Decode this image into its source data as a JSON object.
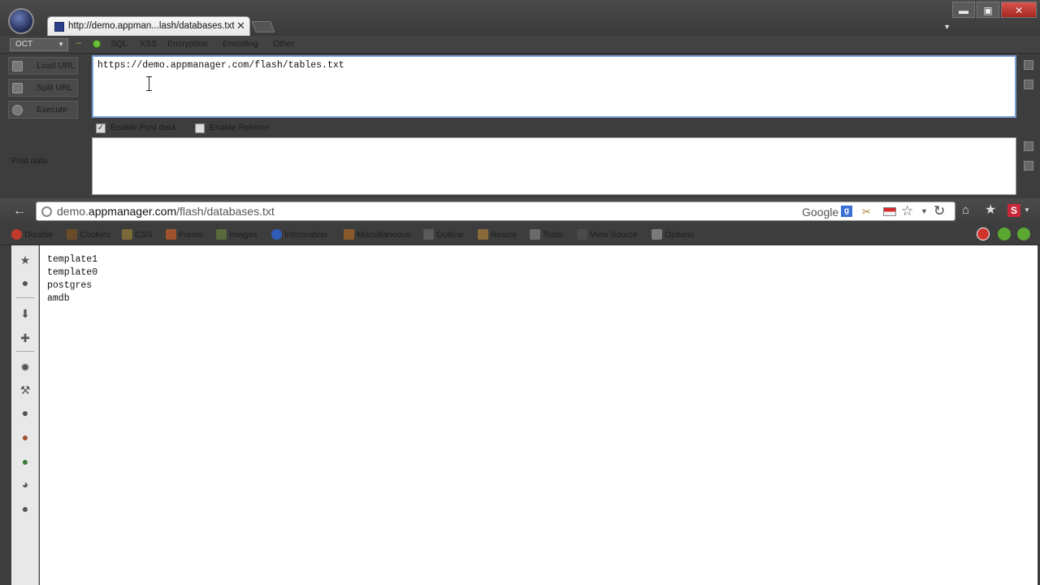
{
  "window": {
    "tab_title": "http://demo.appman...lash/databases.txt",
    "tab_close": "✕",
    "controls": {
      "minimize": "▬",
      "maximize": "▣",
      "close": "✕"
    }
  },
  "hackbar": {
    "select_value": "OCT",
    "menu": [
      "SQL",
      "XSS",
      "Encryption",
      "Encoding",
      "Other"
    ],
    "buttons": {
      "load_url": "Load URL",
      "split_url": "Split URL",
      "execute": "Execute"
    },
    "url_value": "https://demo.appmanager.com/flash/tables.txt",
    "enable_post_label": "Enable Post data",
    "enable_post_checked": true,
    "enable_referrer_label": "Enable Referrer",
    "enable_referrer_checked": false,
    "post_data_label": "Post data",
    "post_data_value": ""
  },
  "navbar": {
    "url_prefix": "demo.",
    "url_domain": "appmanager.com",
    "url_path": "/flash/databases.txt",
    "search_engine": "Google"
  },
  "webdev_toolbar": {
    "items": [
      "Disable",
      "Cookies",
      "CSS",
      "Forms",
      "Images",
      "Information",
      "Miscellaneous",
      "Outline",
      "Resize",
      "Tools",
      "View Source",
      "Options"
    ],
    "item_colors": [
      "#c0392b",
      "#6b4a2a",
      "#7a6a3a",
      "#a0522d",
      "#5a6a3a",
      "#2e5cb8",
      "#8a5a2a",
      "#5a5a5a",
      "#8a6a3a",
      "#6a6a6a",
      "#4a4a4a",
      "#7a7a7a"
    ]
  },
  "content": {
    "lines": [
      "template1",
      "template0",
      "postgres",
      "amdb"
    ]
  }
}
